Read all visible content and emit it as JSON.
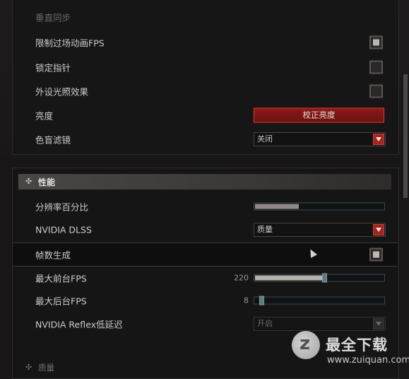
{
  "display_section": {
    "rows": [
      {
        "label": "垂直同步"
      },
      {
        "label": "限制过场动画FPS",
        "checked": true
      },
      {
        "label": "锁定指针",
        "checked": false
      },
      {
        "label": "外设光照效果",
        "checked": false
      },
      {
        "label": "亮度",
        "button_label": "校正亮度"
      },
      {
        "label": "色盲滤镜",
        "value": "关闭"
      }
    ]
  },
  "performance_section": {
    "title": "性能",
    "rows": [
      {
        "label": "分辨率百分比",
        "level": 0.34
      },
      {
        "label": "NVIDIA DLSS",
        "value": "质量"
      },
      {
        "label": "帧数生成",
        "checked": true
      },
      {
        "label": "最大前台FPS",
        "value": "220",
        "level": 0.53
      },
      {
        "label": "最大后台FPS",
        "value": "8",
        "level": 0.04
      },
      {
        "label": "NVIDIA Reflex低延迟",
        "value": "开启",
        "disabled": true
      }
    ]
  },
  "next_section": {
    "title": "质量"
  },
  "watermark": {
    "title": "最全下载",
    "url": "www.zuiquan.com"
  },
  "colors": {
    "accent_red": "#a2241f",
    "background": "#1a1818",
    "text": "#cfcbc6"
  },
  "icons": {
    "section": "expand-icon",
    "cursor": "mouse-cursor-icon",
    "logo": "zuiquan-logo-icon"
  }
}
